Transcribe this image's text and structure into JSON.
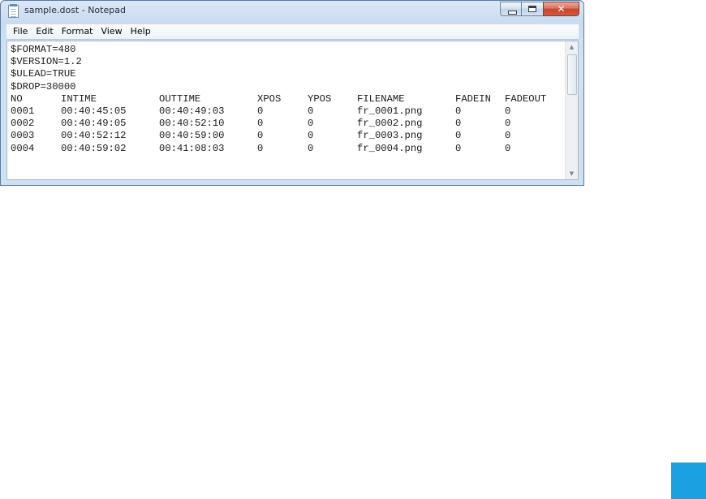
{
  "window": {
    "title": "sample.dost - Notepad",
    "icon": "notepad-icon"
  },
  "caption_buttons": {
    "minimize_icon": "minimize-icon",
    "maximize_icon": "maximize-icon",
    "close_icon": "close-icon",
    "close_glyph": "✕"
  },
  "menu": {
    "items": [
      "File",
      "Edit",
      "Format",
      "View",
      "Help"
    ]
  },
  "document": {
    "header_lines": [
      "$FORMAT=480",
      "$VERSION=1.2",
      "$ULEAD=TRUE",
      "$DROP=30000"
    ],
    "columns": [
      "NO",
      "INTIME",
      "OUTTIME",
      "XPOS",
      "YPOS",
      "FILENAME",
      "FADEIN",
      "FADEOUT"
    ],
    "rows": [
      [
        "0001",
        "00:40:45:05",
        "00:40:49:03",
        "0",
        "0",
        "fr_0001.png",
        "0",
        "0"
      ],
      [
        "0002",
        "00:40:49:05",
        "00:40:52:10",
        "0",
        "0",
        "fr_0002.png",
        "0",
        "0"
      ],
      [
        "0003",
        "00:40:52:12",
        "00:40:59:00",
        "0",
        "0",
        "fr_0003.png",
        "0",
        "0"
      ],
      [
        "0004",
        "00:40:59:02",
        "00:41:08:03",
        "0",
        "0",
        "fr_0004.png",
        "0",
        "0"
      ]
    ]
  },
  "scrollbar": {
    "up_arrow": "▲",
    "down_arrow": "▼"
  },
  "colors": {
    "accent_square": "#1ba1e2",
    "close_button": "#c7472f"
  }
}
